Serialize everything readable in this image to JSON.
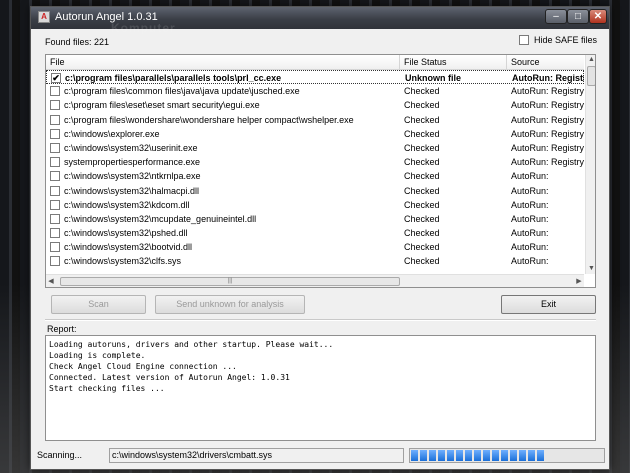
{
  "window": {
    "title": "Autorun Angel 1.0.31",
    "watermark": "Komputer",
    "controls": {
      "minimize": "–",
      "maximize": "□",
      "close": "✕"
    }
  },
  "found_files": "Found files: 221",
  "hide_safe": {
    "label": "Hide SAFE files",
    "checked": false
  },
  "table": {
    "columns": {
      "file": "File",
      "status": "File Status",
      "source": "Source"
    },
    "rows": [
      {
        "file": "c:\\program files\\parallels\\parallels tools\\prl_cc.exe",
        "status": "Unknown file",
        "source": "AutoRun: Registry",
        "checked": true
      },
      {
        "file": "c:\\program files\\common files\\java\\java update\\jusched.exe",
        "status": "Checked",
        "source": "AutoRun: Registry"
      },
      {
        "file": "c:\\program files\\eset\\eset smart security\\egui.exe",
        "status": "Checked",
        "source": "AutoRun: Registry"
      },
      {
        "file": "c:\\program files\\wondershare\\wondershare helper compact\\wshelper.exe",
        "status": "Checked",
        "source": "AutoRun: Registry"
      },
      {
        "file": "c:\\windows\\explorer.exe",
        "status": "Checked",
        "source": "AutoRun: Registry"
      },
      {
        "file": "c:\\windows\\system32\\userinit.exe",
        "status": "Checked",
        "source": "AutoRun: Registry"
      },
      {
        "file": "systempropertiesperformance.exe",
        "status": "Checked",
        "source": "AutoRun: Registry"
      },
      {
        "file": "c:\\windows\\system32\\ntkrnlpa.exe",
        "status": "Checked",
        "source": "AutoRun:"
      },
      {
        "file": "c:\\windows\\system32\\halmacpi.dll",
        "status": "Checked",
        "source": "AutoRun:"
      },
      {
        "file": "c:\\windows\\system32\\kdcom.dll",
        "status": "Checked",
        "source": "AutoRun:"
      },
      {
        "file": "c:\\windows\\system32\\mcupdate_genuineintel.dll",
        "status": "Checked",
        "source": "AutoRun:"
      },
      {
        "file": "c:\\windows\\system32\\pshed.dll",
        "status": "Checked",
        "source": "AutoRun:"
      },
      {
        "file": "c:\\windows\\system32\\bootvid.dll",
        "status": "Checked",
        "source": "AutoRun:"
      },
      {
        "file": "c:\\windows\\system32\\clfs.sys",
        "status": "Checked",
        "source": "AutoRun:"
      }
    ],
    "check_glyph": "✔",
    "hscroll_grip": "|||",
    "arrows": {
      "left": "◀",
      "right": "▶",
      "up": "▲",
      "down": "▼"
    }
  },
  "buttons": {
    "scan": "Scan",
    "send": "Send unknown for analysis",
    "exit": "Exit"
  },
  "report": {
    "label": "Report:",
    "lines": [
      "Loading autoruns, drivers and other startup. Please wait...",
      "Loading is complete.",
      "Check Angel Cloud Engine connection ...",
      "Connected. Latest version of Autorun Angel: 1.0.31",
      "Start checking files ..."
    ]
  },
  "status": {
    "label": "Scanning...",
    "path": "c:\\windows\\system32\\drivers\\cmbatt.sys",
    "progress_segments": 15
  },
  "colors": {
    "progress": "#1a6fd8",
    "titlebar": "#3b3f47"
  }
}
